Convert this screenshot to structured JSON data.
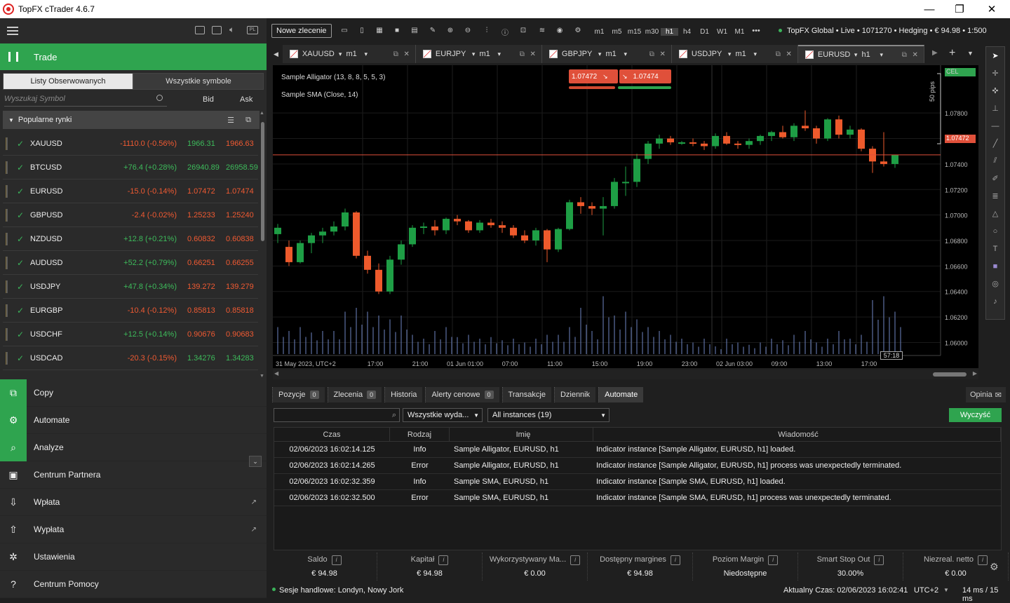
{
  "window": {
    "title": "TopFX cTrader 4.6.7",
    "min": "—",
    "max": "❐",
    "close": "✕"
  },
  "left": {
    "trade_label": "Trade",
    "tabs": [
      "Listy Obserwowanych",
      "Wszystkie symbole"
    ],
    "search_placeholder": "Wyszukaj Symbol",
    "bid_label": "Bid",
    "ask_label": "Ask",
    "group_label": "Popularne rynki",
    "watchlist": [
      {
        "sym": "XAUUSD",
        "chg": "-1110.0 (-0.56%)",
        "dir": "neg",
        "bid": "1966.31",
        "ask": "1966.63",
        "bidc": "pos",
        "askc": "neg"
      },
      {
        "sym": "BTCUSD",
        "chg": "+76.4 (+0.28%)",
        "dir": "pos",
        "bid": "26940.89",
        "ask": "26958.59",
        "bidc": "pos",
        "askc": "pos"
      },
      {
        "sym": "EURUSD",
        "chg": "-15.0 (-0.14%)",
        "dir": "neg",
        "bid": "1.07472",
        "ask": "1.07474",
        "bidc": "neg",
        "askc": "neg"
      },
      {
        "sym": "GBPUSD",
        "chg": "-2.4 (-0.02%)",
        "dir": "neg",
        "bid": "1.25233",
        "ask": "1.25240",
        "bidc": "neg",
        "askc": "neg"
      },
      {
        "sym": "NZDUSD",
        "chg": "+12.8 (+0.21%)",
        "dir": "pos",
        "bid": "0.60832",
        "ask": "0.60838",
        "bidc": "neg",
        "askc": "neg"
      },
      {
        "sym": "AUDUSD",
        "chg": "+52.2 (+0.79%)",
        "dir": "pos",
        "bid": "0.66251",
        "ask": "0.66255",
        "bidc": "neg",
        "askc": "neg"
      },
      {
        "sym": "USDJPY",
        "chg": "+47.8 (+0.34%)",
        "dir": "pos",
        "bid": "139.272",
        "ask": "139.279",
        "bidc": "neg",
        "askc": "neg"
      },
      {
        "sym": "EURGBP",
        "chg": "-10.4 (-0.12%)",
        "dir": "neg",
        "bid": "0.85813",
        "ask": "0.85818",
        "bidc": "neg",
        "askc": "neg"
      },
      {
        "sym": "USDCHF",
        "chg": "+12.5 (+0.14%)",
        "dir": "pos",
        "bid": "0.90676",
        "ask": "0.90683",
        "bidc": "neg",
        "askc": "neg"
      },
      {
        "sym": "USDCAD",
        "chg": "-20.3 (-0.15%)",
        "dir": "neg",
        "bid": "1.34276",
        "ask": "1.34283",
        "bidc": "pos",
        "askc": "pos"
      }
    ],
    "nav": [
      {
        "label": "Copy",
        "icon": "⧉",
        "green": true,
        "ext": false,
        "name": "copy"
      },
      {
        "label": "Automate",
        "icon": "⚙",
        "green": true,
        "ext": false,
        "name": "automate"
      },
      {
        "label": "Analyze",
        "icon": "⌕",
        "green": true,
        "ext": false,
        "name": "analyze"
      },
      {
        "label": "Centrum Partnera",
        "icon": "▣",
        "green": false,
        "ext": false,
        "name": "centrum-partnera"
      },
      {
        "label": "Wpłata",
        "icon": "⇩",
        "green": false,
        "ext": true,
        "name": "wplata"
      },
      {
        "label": "Wypłata",
        "icon": "⇧",
        "green": false,
        "ext": true,
        "name": "wyplata"
      },
      {
        "label": "Ustawienia",
        "icon": "✲",
        "green": false,
        "ext": false,
        "name": "ustawienia"
      },
      {
        "label": "Centrum Pomocy",
        "icon": "?",
        "green": false,
        "ext": false,
        "name": "centrum-pomocy"
      }
    ]
  },
  "toolbar": {
    "new_order": "Nowe zlecenie",
    "timeframes": [
      "m1",
      "m5",
      "m15",
      "m30",
      "h1",
      "h4",
      "D1",
      "W1",
      "M1"
    ],
    "more": "•••",
    "account": "TopFX Global • Live • 1071270 • Hedging • € 94.98 • 1:500"
  },
  "chart_tabs": [
    {
      "sym": "XAUUSD",
      "tf": "m1"
    },
    {
      "sym": "EURJPY",
      "tf": "m1"
    },
    {
      "sym": "GBPJPY",
      "tf": "m1"
    },
    {
      "sym": "USDJPY",
      "tf": "m1"
    },
    {
      "sym": "EURUSD",
      "tf": "h1",
      "active": true
    }
  ],
  "chart": {
    "indicator1": "Sample Alligator (13, 8, 8, 5, 5, 3)",
    "indicator2": "Sample SMA (Close, 14)",
    "sell_price": "1.07472",
    "buy_price": "1.07474",
    "cel_label": "CEL",
    "pips_label": "50 pips",
    "current_price": "1.07472",
    "countdown": "57:18",
    "y_ticks": [
      "1.07800",
      "1.07600",
      "1.07400",
      "1.07200",
      "1.07000",
      "1.06800",
      "1.06600",
      "1.06400",
      "1.06200",
      "1.06000"
    ],
    "x_ticks": [
      "31 May 2023, UTC+2",
      "17:00",
      "21:00",
      "01 Jun 01:00",
      "07:00",
      "11:00",
      "15:00",
      "19:00",
      "23:00",
      "02 Jun 03:00",
      "09:00",
      "13:00",
      "17:00"
    ],
    "colors": {
      "up": "#1e9e45",
      "down": "#ee5a2c",
      "volume": "#6f86c4",
      "price_line": "#e0503a"
    }
  },
  "chart_data": {
    "type": "candlestick",
    "symbol": "EURUSD",
    "timeframe": "h1",
    "ylim": [
      1.0592,
      1.0812
    ],
    "candles": [
      [
        1.0685,
        1.0693,
        1.0678,
        1.069
      ],
      [
        1.0675,
        1.068,
        1.066,
        1.0663
      ],
      [
        1.0663,
        1.068,
        1.0662,
        1.0678
      ],
      [
        1.0678,
        1.0686,
        1.067,
        1.0684
      ],
      [
        1.0684,
        1.069,
        1.0678,
        1.0687
      ],
      [
        1.0687,
        1.0695,
        1.0684,
        1.0691
      ],
      [
        1.0691,
        1.0705,
        1.0688,
        1.0702
      ],
      [
        1.0702,
        1.0703,
        1.0666,
        1.0668
      ],
      [
        1.0668,
        1.0672,
        1.0654,
        1.0657
      ],
      [
        1.0657,
        1.0662,
        1.0638,
        1.064
      ],
      [
        1.064,
        1.0668,
        1.0638,
        1.0665
      ],
      [
        1.0665,
        1.068,
        1.0661,
        1.0677
      ],
      [
        1.0677,
        1.0692,
        1.0675,
        1.069
      ],
      [
        1.069,
        1.0694,
        1.0685,
        1.0691
      ],
      [
        1.0691,
        1.0696,
        1.0684,
        1.0688
      ],
      [
        1.0688,
        1.0698,
        1.0685,
        1.0697
      ],
      [
        1.0697,
        1.07,
        1.0692,
        1.0695
      ],
      [
        1.0695,
        1.0696,
        1.0686,
        1.0688
      ],
      [
        1.0688,
        1.0696,
        1.0686,
        1.0694
      ],
      [
        1.0694,
        1.0697,
        1.069,
        1.0692
      ],
      [
        1.0692,
        1.0695,
        1.0686,
        1.069
      ],
      [
        1.069,
        1.0692,
        1.0682,
        1.0684
      ],
      [
        1.0684,
        1.0688,
        1.0678,
        1.068
      ],
      [
        1.068,
        1.069,
        1.0676,
        1.0688
      ],
      [
        1.0688,
        1.0689,
        1.0663,
        1.0673
      ],
      [
        1.0673,
        1.069,
        1.0671,
        1.0689
      ],
      [
        1.0689,
        1.0712,
        1.0688,
        1.071
      ],
      [
        1.071,
        1.0714,
        1.0701,
        1.0707
      ],
      [
        1.0707,
        1.071,
        1.07,
        1.0705
      ],
      [
        1.0705,
        1.0714,
        1.0684,
        1.0707
      ],
      [
        1.0707,
        1.0729,
        1.0705,
        1.0726
      ],
      [
        1.0726,
        1.0738,
        1.0715,
        1.0726
      ],
      [
        1.0726,
        1.0748,
        1.0722,
        1.0744
      ],
      [
        1.0744,
        1.0758,
        1.074,
        1.0756
      ],
      [
        1.0756,
        1.0763,
        1.0752,
        1.076
      ],
      [
        1.076,
        1.0762,
        1.0755,
        1.0757
      ],
      [
        1.0757,
        1.0758,
        1.0755,
        1.0757
      ],
      [
        1.0757,
        1.076,
        1.0754,
        1.0756
      ],
      [
        1.0756,
        1.0758,
        1.0751,
        1.0754
      ],
      [
        1.0754,
        1.0764,
        1.0752,
        1.0762
      ],
      [
        1.0762,
        1.0765,
        1.0755,
        1.0756
      ],
      [
        1.0756,
        1.0758,
        1.0752,
        1.0755
      ],
      [
        1.0755,
        1.076,
        1.0752,
        1.0758
      ],
      [
        1.0758,
        1.0763,
        1.0755,
        1.0762
      ],
      [
        1.0762,
        1.0766,
        1.0758,
        1.0765
      ],
      [
        1.0765,
        1.077,
        1.076,
        1.0761
      ],
      [
        1.0761,
        1.0772,
        1.0758,
        1.077
      ],
      [
        1.077,
        1.0782,
        1.0766,
        1.0768
      ],
      [
        1.0768,
        1.077,
        1.0756,
        1.076
      ],
      [
        1.076,
        1.0776,
        1.0758,
        1.0775
      ],
      [
        1.0775,
        1.0778,
        1.076,
        1.0763
      ],
      [
        1.0763,
        1.077,
        1.076,
        1.0767
      ],
      [
        1.0767,
        1.0768,
        1.075,
        1.0752
      ],
      [
        1.0752,
        1.0754,
        1.0733,
        1.0742
      ],
      [
        1.0742,
        1.0765,
        1.0738,
        1.074
      ],
      [
        1.074,
        1.0747,
        1.0737,
        1.0747
      ]
    ],
    "volume": [
      0.35,
      0.3,
      0.35,
      0.28,
      0.3,
      0.3,
      0.55,
      0.6,
      0.55,
      0.5,
      0.45,
      0.5,
      0.25,
      0.2,
      0.3,
      0.35,
      0.22,
      0.25,
      0.2,
      0.22,
      0.18,
      0.2,
      0.15,
      0.2,
      0.25,
      0.25,
      0.35,
      0.6,
      0.3,
      0.75,
      0.5,
      0.55,
      0.45,
      0.35,
      0.3,
      0.25,
      0.2,
      0.15,
      0.2,
      0.1,
      0.2,
      0.15,
      0.12,
      0.15,
      0.2,
      0.18,
      0.25,
      0.3,
      0.15,
      0.2,
      0.3,
      0.2,
      0.25,
      0.7,
      0.75,
      0.55
    ]
  },
  "bottom": {
    "tabs": [
      {
        "label": "Pozycje",
        "count": "0"
      },
      {
        "label": "Zlecenia",
        "count": "0"
      },
      {
        "label": "Historia",
        "count": null
      },
      {
        "label": "Alerty cenowe",
        "count": "0"
      },
      {
        "label": "Transakcje",
        "count": null
      },
      {
        "label": "Dziennik",
        "count": null
      },
      {
        "label": "Automate",
        "count": null,
        "active": true
      }
    ],
    "opinion": "Opinia",
    "filter_type": "Wszystkie wyda...",
    "filter_instances": "All instances (19)",
    "clear": "Wyczyść",
    "log_headers": [
      "Czas",
      "Rodzaj",
      "Imię",
      "Wiadomość"
    ],
    "log_rows": [
      [
        "02/06/2023 16:02:14.125",
        "Info",
        "Sample Alligator, EURUSD, h1",
        "Indicator instance [Sample Alligator, EURUSD, h1] loaded."
      ],
      [
        "02/06/2023 16:02:14.265",
        "Error",
        "Sample Alligator, EURUSD, h1",
        "Indicator instance [Sample Alligator, EURUSD, h1] process was unexpectedly terminated."
      ],
      [
        "02/06/2023 16:02:32.359",
        "Info",
        "Sample SMA, EURUSD, h1",
        "Indicator instance [Sample SMA, EURUSD, h1] loaded."
      ],
      [
        "02/06/2023 16:02:32.500",
        "Error",
        "Sample SMA, EURUSD, h1",
        "Indicator instance [Sample SMA, EURUSD, h1] process was unexpectedly terminated."
      ]
    ],
    "summary": [
      {
        "label": "Saldo",
        "value": "€ 94.98"
      },
      {
        "label": "Kapitał",
        "value": "€ 94.98"
      },
      {
        "label": "Wykorzystywany Ma...",
        "value": "€ 0.00"
      },
      {
        "label": "Dostępny margines",
        "value": "€ 94.98"
      },
      {
        "label": "Poziom Margin",
        "value": "Niedostępne"
      },
      {
        "label": "Smart Stop Out",
        "value": "30.00%"
      },
      {
        "label": "Niezreal. netto",
        "value": "€ 0.00"
      }
    ]
  },
  "status": {
    "sessions": "Sesje handlowe: Londyn, Nowy Jork",
    "time": "Aktualny Czas: 02/06/2023 16:02:41",
    "tz": "UTC+2",
    "latency": "14 ms / 15 ms"
  }
}
